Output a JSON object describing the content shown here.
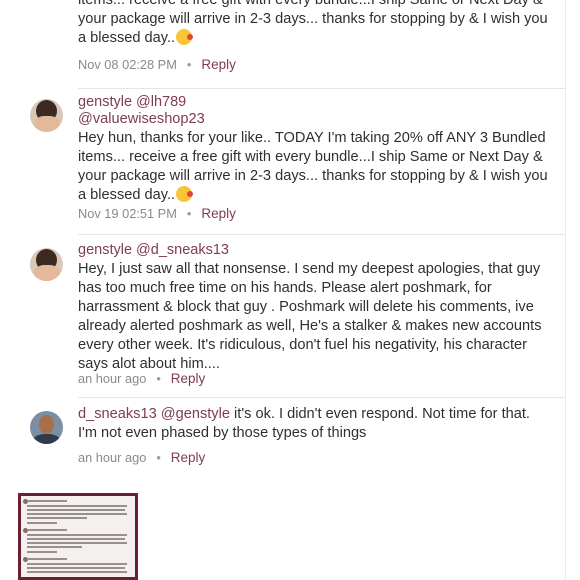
{
  "comments": [
    {
      "id": "c0",
      "text_partial": "items... receive a free gift with every bundle...I ship Same or Next Day & your package will arrive in 2-3 days... thanks for stopping by & I wish you a blessed day..",
      "time": "Nov 08 02:28 PM",
      "reply": "Reply"
    },
    {
      "id": "c1",
      "user": "genstyle",
      "mention": "@lh789",
      "mention2": "@valuewiseshop23",
      "text": "Hey hun, thanks for your like.. TODAY I'm taking 20% off ANY 3 Bundled items... receive a free gift with every bundle...I ship Same or Next Day & your package will arrive in 2-3 days... thanks for stopping by & I wish you a blessed day..",
      "time": "Nov 19 02:51 PM",
      "reply": "Reply"
    },
    {
      "id": "c2",
      "user": "genstyle",
      "mention": "@d_sneaks13",
      "text": "Hey, I just saw all that nonsense. I send my deepest apologies, that guy has too much free time on his hands. Please alert poshmark, for harrassment & block that guy . Poshmark will delete his comments, ive already alerted poshmark as well, He's a stalker & makes new accounts every other week. It's ridiculous, don't fuel his negativity, his character says alot about him....",
      "time": "an hour ago",
      "reply": "Reply"
    },
    {
      "id": "c3",
      "user": "d_sneaks13",
      "mention": "@genstyle",
      "text": "it's ok. I didn't even respond. Not time for that. I'm not even phased by those types of things",
      "time": "an hour ago",
      "reply": "Reply"
    }
  ],
  "icons": {
    "emoji": "kissing-face-emoji",
    "avatar_female": "user-avatar",
    "avatar_male": "user-avatar"
  }
}
